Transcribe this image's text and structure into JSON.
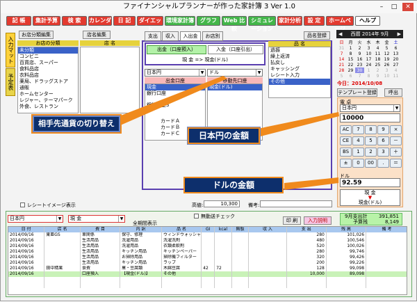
{
  "window": {
    "title": "ファイナンシャルプランナーが作った家計簿 3 Ver 1.0",
    "min": "–",
    "max": "□",
    "close": "✕"
  },
  "menu": [
    {
      "label": "記 帳",
      "bg": "#e33a2f",
      "color": "#fff"
    },
    {
      "label": "集計予算",
      "bg": "#e33a2f",
      "color": "#fff"
    },
    {
      "label": "検 索",
      "bg": "#e33a2f",
      "color": "#fff"
    },
    {
      "label": "カレンダー",
      "bg": "#e33a2f",
      "color": "#fff"
    },
    {
      "label": "日 記",
      "bg": "#e33a2f",
      "color": "#fff"
    },
    {
      "label": "ダイエット",
      "bg": "#e33a2f",
      "color": "#fff"
    },
    {
      "label": "環境家計簿",
      "bg": "#43b649",
      "color": "#fff"
    },
    {
      "label": "グラフ",
      "bg": "#43b649",
      "color": "#fff"
    },
    {
      "label": "Web 比較",
      "bg": "#43b649",
      "color": "#fff"
    },
    {
      "label": "シミュレーション",
      "bg": "#43b649",
      "color": "#fff"
    },
    {
      "label": "家計分析",
      "bg": "#e33a2f",
      "color": "#fff"
    },
    {
      "label": "設 定",
      "bg": "#e33a2f",
      "color": "#fff"
    },
    {
      "label": "ホームページ",
      "bg": "#e33a2f",
      "color": "#fff"
    },
    {
      "label": "ヘルプ",
      "bg": "#fff",
      "color": "#000"
    }
  ],
  "left_tabs": [
    "入力マット",
    "予定表"
  ],
  "left_panel": {
    "category_btn": "お店分類編集",
    "shop_btn": "店名編集",
    "cat_header": "お店の分類",
    "shop_header": "店 名",
    "categories": [
      "未分類",
      "コンビニ",
      "百貨店、スーパー",
      "食料品店",
      "衣料品店",
      "薬局、ドラッグストア",
      "通販",
      "ホームセンター",
      "レジャー、テーマパーク",
      "外食、レストラン"
    ],
    "receipt_check": "レシートイメージ表示"
  },
  "center": {
    "tabs": [
      "支出",
      "収入",
      "入出金",
      "お店別"
    ],
    "deposit": "出金（口座預入）",
    "withdraw": "入金（口座引出）",
    "conversion": "現 金 => 現金(ドル)",
    "from_currency": "日本円",
    "to_currency": "ドル",
    "out_header": "出金口座",
    "in_header": "移動先口座",
    "in_value": "現金(ドル)",
    "out_items": [
      "現金",
      "銀行口座"
    ],
    "bg_items": [
      "銀行口座3",
      "カードＡ",
      "カードＢ",
      "カードＣ"
    ],
    "balance_label": "高値:",
    "balance_value": "10,300",
    "note_label": "備考:"
  },
  "item_panel": {
    "btn": "品名登録",
    "header": "品 名",
    "items": [
      "過振",
      "繰上返済",
      "払戻し",
      "キャッシング",
      "レシート入力",
      "その他"
    ]
  },
  "calendar": {
    "title": "西暦 2014年 9月",
    "prev": "◀",
    "next": "▶",
    "days": [
      "日",
      "月",
      "火",
      "水",
      "木",
      "金",
      "土"
    ],
    "weeks": [
      [
        "31",
        "1",
        "2",
        "3",
        "4",
        "5",
        "6"
      ],
      [
        "7",
        "8",
        "9",
        "10",
        "11",
        "12",
        "13"
      ],
      [
        "14",
        "15",
        "16",
        "17",
        "18",
        "19",
        "20"
      ],
      [
        "21",
        "22",
        "23",
        "24",
        "25",
        "26",
        "27"
      ],
      [
        "28",
        "29",
        "30",
        "1",
        "2",
        "3",
        "4"
      ],
      [
        "5",
        "6",
        "7",
        "8",
        "9",
        "10",
        "11"
      ]
    ],
    "today": "今日：2014/10/08"
  },
  "template": {
    "reg": "テンプレート登録",
    "call": "呼出"
  },
  "calc": {
    "title": "電 卓",
    "yen_label": "日本円",
    "yen_value": "10000",
    "usd_label": "ドル",
    "usd_value": "92.59",
    "keys": [
      [
        "AC",
        "7",
        "8",
        "9",
        "×"
      ],
      [
        "CE",
        "4",
        "5",
        "6",
        "－"
      ],
      [
        "BS",
        "1",
        "2",
        "3",
        "＋"
      ],
      [
        "±",
        "0",
        "00",
        ".",
        "＝"
      ]
    ],
    "convert_top": "現 金",
    "convert_arrow": "▼",
    "convert_bottom": "現金(ドル)"
  },
  "callouts": {
    "switch": "相手先通貨の切り替え",
    "yen": "日本円の金額",
    "usd": "ドルの金額"
  },
  "bottom": {
    "account": "日本円",
    "account2": "現 金",
    "all_check": "全期間表示",
    "nomove_check": "無動送チェック",
    "print": "印 刷",
    "input_btn": "入力説明",
    "summary": {
      "l1": "9月支出計",
      "v1": "391,851",
      "l2": "予算残",
      "v2": "8,149"
    },
    "headers": [
      "日 付",
      "店 名",
      "費 目",
      "内 訳",
      "品 名",
      "GI",
      "kcal",
      "無駄",
      "収 入",
      "支 出",
      "残 高",
      "備 考"
    ],
    "rows": [
      [
        "2014/09/16",
        "東亜GS",
        "車関係",
        "保守、修理",
        "ウィンドウォッシャー",
        "",
        "",
        "",
        "",
        "280",
        "101,026",
        ""
      ],
      [
        "2014/09/16",
        "",
        "生活用品",
        "洗濯用品",
        "洗濯洗剤",
        "",
        "",
        "",
        "",
        "480",
        "100,546",
        ""
      ],
      [
        "2014/09/16",
        "",
        "生活用品",
        "洗濯用品",
        "衣類柔軟剤",
        "",
        "",
        "",
        "",
        "520",
        "100,026",
        ""
      ],
      [
        "2014/09/16",
        "",
        "生活用品",
        "キッチン用品",
        "キッチンペーパー",
        "",
        "",
        "",
        "",
        "280",
        "99,746",
        ""
      ],
      [
        "2014/09/16",
        "",
        "生活用品",
        "お掃除用品",
        "掃除機フィルター",
        "",
        "",
        "",
        "",
        "320",
        "99,426",
        ""
      ],
      [
        "2014/09/16",
        "",
        "生活用品",
        "キッチン用品",
        "ラップ",
        "",
        "",
        "",
        "",
        "200",
        "99,226",
        ""
      ],
      [
        "2014/09/16",
        "田中精果",
        "食費",
        "菓・豆腐類",
        "木綿豆腐",
        "42",
        "72",
        "",
        "",
        "128",
        "99,098",
        ""
      ],
      [
        "2014/09/16",
        "",
        "口座預入",
        "【現金(ドル)】",
        "その他",
        "",
        "",
        "",
        "",
        "10,000",
        "89,098",
        ""
      ],
      [
        "",
        "",
        "",
        "",
        "",
        "",
        "",
        "",
        "",
        "",
        "",
        ""
      ],
      [
        "",
        "",
        "",
        "",
        "",
        "",
        "",
        "",
        "",
        "",
        "",
        ""
      ]
    ]
  }
}
